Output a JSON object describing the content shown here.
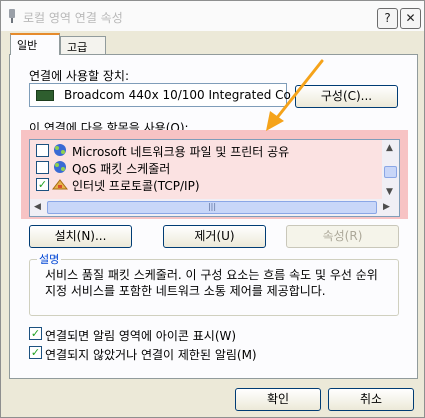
{
  "window": {
    "title": "로컬 영역 연결 속성",
    "help_button": "?",
    "close_button": "✕"
  },
  "tabs": [
    {
      "label": "일반",
      "active": true
    },
    {
      "label": "고급",
      "active": false
    }
  ],
  "general": {
    "device_label": "연결에 사용할 장치:",
    "device_name": "Broadcom 440x 10/100 Integrated Co",
    "configure_button": "구성(C)...",
    "items_label": "이 연결에 다음 항목을 사용(O):",
    "items": [
      {
        "label": "Microsoft 네트워크용 파일 및 프린터 공유",
        "checked": false,
        "icon": "network-share-icon"
      },
      {
        "label": "QoS 패킷 스케줄러",
        "checked": false,
        "icon": "network-service-icon"
      },
      {
        "label": "인터넷 프로토콜(TCP/IP)",
        "checked": true,
        "icon": "protocol-icon"
      }
    ],
    "install_button": "설치(N)...",
    "remove_button": "제거(U)",
    "properties_button": "속성(R)",
    "description_legend": "설명",
    "description_text": "서비스 품질 패킷 스케줄러. 이 구성 요소는 흐름 속도 및 우선 순위 지정 서비스를 포함한 네트워크 소통 제어를 제공합니다.",
    "show_icon_checkbox": {
      "label": "연결되면 알림 영역에 아이콘 표시(W)",
      "checked": true
    },
    "notify_checkbox": {
      "label": "연결되지 않았거나 연결이 제한된 알림(M)",
      "checked": true
    }
  },
  "footer": {
    "ok_button": "확인",
    "cancel_button": "취소"
  },
  "colors": {
    "highlight": "#f7c3c4",
    "arrow": "#f5a31a",
    "accent_tab": "#e68b2c"
  }
}
